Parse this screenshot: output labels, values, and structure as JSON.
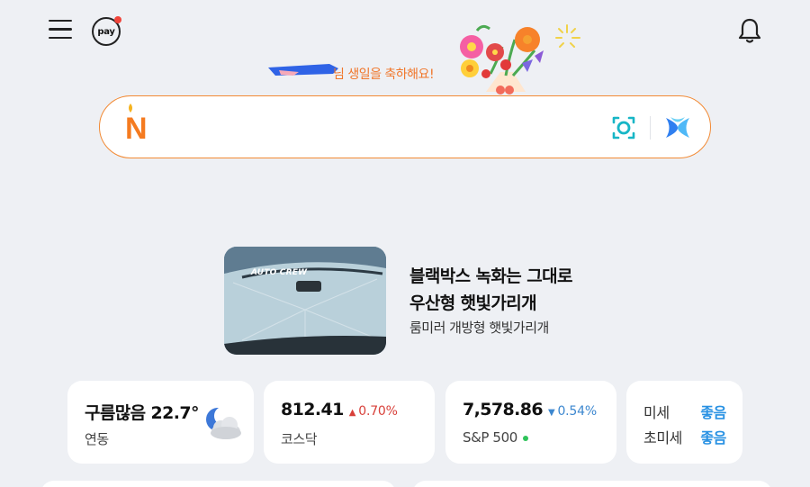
{
  "header": {
    "menu_icon": "hamburger-menu-icon",
    "pay_label": "pay",
    "bell_icon": "bell-icon"
  },
  "birthday": {
    "message": "님 생일을 축하해요!",
    "decoration": "flower-bouquet"
  },
  "search": {
    "logo_letter": "N",
    "lens_icon": "lens-camera-icon",
    "ai_icon": "ai-sparkle-icon",
    "colors": {
      "border": "#f28a34",
      "logo": "#f57b20",
      "lens": "#17b6c6",
      "ai": "#2f7ff0"
    }
  },
  "ad": {
    "thumb_brand": "AUTO CREW",
    "title_line1": "블랙박스 녹화는 그대로",
    "title_line2": "우산형 햇빛가리개",
    "subtitle": "룸미러 개방형 햇빛가리개"
  },
  "widgets": {
    "weather": {
      "condition": "구름많음",
      "temp": "22.7°",
      "location": "연동",
      "icon": "partly-cloudy-night-icon"
    },
    "kosdaq": {
      "value": "812.41",
      "direction": "up",
      "change": "0.70%",
      "name": "코스닥"
    },
    "sp500": {
      "value": "7,578.86",
      "direction": "down",
      "change": "0.54%",
      "name": "S&P 500"
    },
    "dust": {
      "fine_label": "미세",
      "fine_value": "좋음",
      "ultra_label": "초미세",
      "ultra_value": "좋음"
    }
  }
}
